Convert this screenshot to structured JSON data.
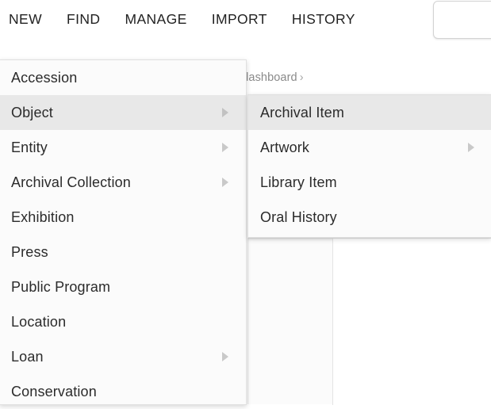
{
  "topbar": {
    "nav_items": [
      {
        "label": "NEW",
        "name": "nav-new"
      },
      {
        "label": "FIND",
        "name": "nav-find"
      },
      {
        "label": "MANAGE",
        "name": "nav-manage"
      },
      {
        "label": "IMPORT",
        "name": "nav-import"
      },
      {
        "label": "HISTORY",
        "name": "nav-history"
      }
    ],
    "search_placeholder": ""
  },
  "breadcrumb": {
    "text": "t dashboard",
    "separator": "›"
  },
  "primary_menu": {
    "items": [
      {
        "label": "Accession",
        "has_submenu": false,
        "selected": false
      },
      {
        "label": "Object",
        "has_submenu": true,
        "selected": true
      },
      {
        "label": "Entity",
        "has_submenu": true,
        "selected": false
      },
      {
        "label": "Archival Collection",
        "has_submenu": true,
        "selected": false
      },
      {
        "label": "Exhibition",
        "has_submenu": false,
        "selected": false
      },
      {
        "label": "Press",
        "has_submenu": false,
        "selected": false
      },
      {
        "label": "Public Program",
        "has_submenu": false,
        "selected": false
      },
      {
        "label": "Location",
        "has_submenu": false,
        "selected": false
      },
      {
        "label": "Loan",
        "has_submenu": true,
        "selected": false
      },
      {
        "label": "Conservation",
        "has_submenu": false,
        "selected": false
      }
    ]
  },
  "secondary_menu": {
    "items": [
      {
        "label": "Archival Item",
        "has_submenu": false,
        "selected": true
      },
      {
        "label": "Artwork",
        "has_submenu": true,
        "selected": false
      },
      {
        "label": "Library Item",
        "has_submenu": false,
        "selected": false
      },
      {
        "label": "Oral History",
        "has_submenu": false,
        "selected": false
      }
    ]
  },
  "colors": {
    "menu_background": "#fbfbfb",
    "menu_selected": "#e8e8e8",
    "menu_border": "#e0e0e0",
    "text": "#2b2b2b",
    "nav_text": "#222222",
    "breadcrumb_text": "#8a8a8a",
    "arrow": "#c9c9c9"
  }
}
